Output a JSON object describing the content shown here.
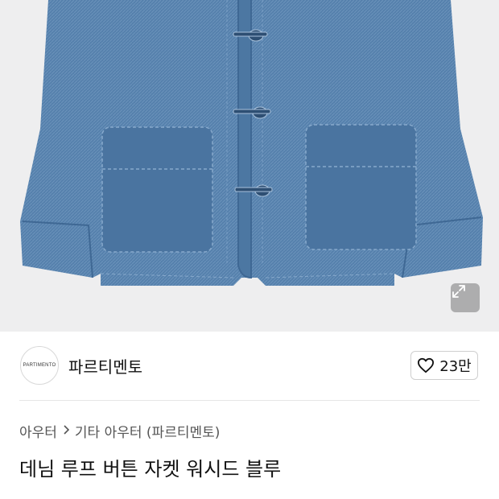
{
  "product_image": {
    "alt": "denim loop button jacket",
    "denim_color": "#4f7aa6",
    "background_color": "#eeeeef"
  },
  "expand_button": {
    "icon": "expand-icon"
  },
  "brand": {
    "logo_text": "PARTIMENTO",
    "name": "파르티멘토"
  },
  "like": {
    "icon": "heart-icon",
    "count": "23만"
  },
  "breadcrumb": {
    "items": [
      "아우터",
      "기타 아우터 (파르티멘토)"
    ],
    "separator_icon": "chevron-right-icon"
  },
  "product": {
    "title": "데님 루프 버튼 자켓 워시드 블루"
  }
}
